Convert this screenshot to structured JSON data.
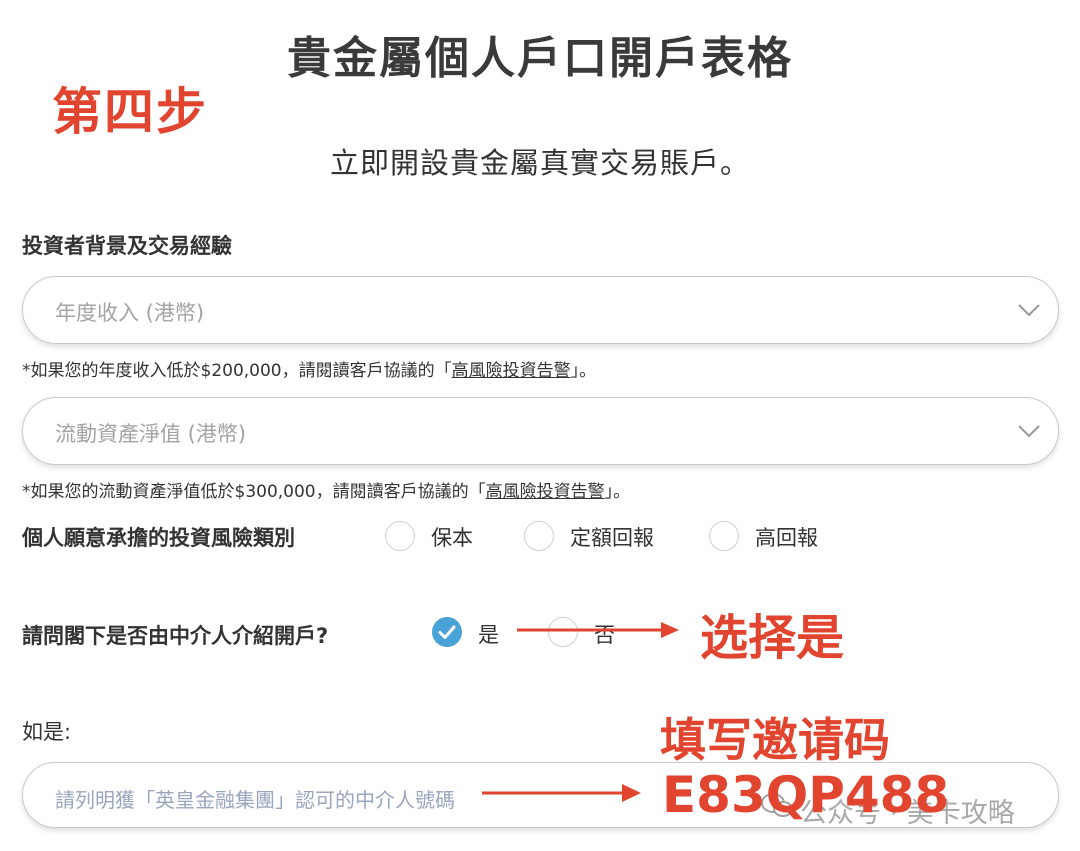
{
  "form": {
    "title": "貴金屬個人戶口開戶表格",
    "subtitle": "立即開設貴金屬真實交易賬戶。",
    "section_heading": "投資者背景及交易經驗",
    "annual_income": {
      "placeholder": "年度收入 (港幣)",
      "note_prefix": "*如果您的年度收入低於$200,000，請閱讀客戶協議的「",
      "note_link": "高風險投資告警",
      "note_suffix": "」。"
    },
    "liquid_assets": {
      "placeholder": "流動資產淨值 (港幣)",
      "note_prefix": "*如果您的流動資產淨值低於$300,000，請閱讀客戶協議的「",
      "note_link": "高風險投資告警",
      "note_suffix": "」。"
    },
    "risk_category": {
      "label": "個人願意承擔的投資風險類別",
      "options": [
        "保本",
        "定額回報",
        "高回報"
      ],
      "selected": null
    },
    "referral": {
      "question": "請問閣下是否由中介人介紹開戶?",
      "options": [
        "是",
        "否"
      ],
      "selected": "是"
    },
    "referral_detail": {
      "label": "如是:",
      "placeholder": "請列明獲「英皇金融集團」認可的中介人號碼"
    }
  },
  "annotations": {
    "step": "第四步",
    "select_yes": "选择是",
    "fill_code": "填写邀请码",
    "code": "E83QP488"
  },
  "watermark": {
    "text": "公众号 · 美卡攻略"
  },
  "colors": {
    "annotation_red": "#e2452f",
    "radio_checked_blue": "#4aa3d6"
  }
}
